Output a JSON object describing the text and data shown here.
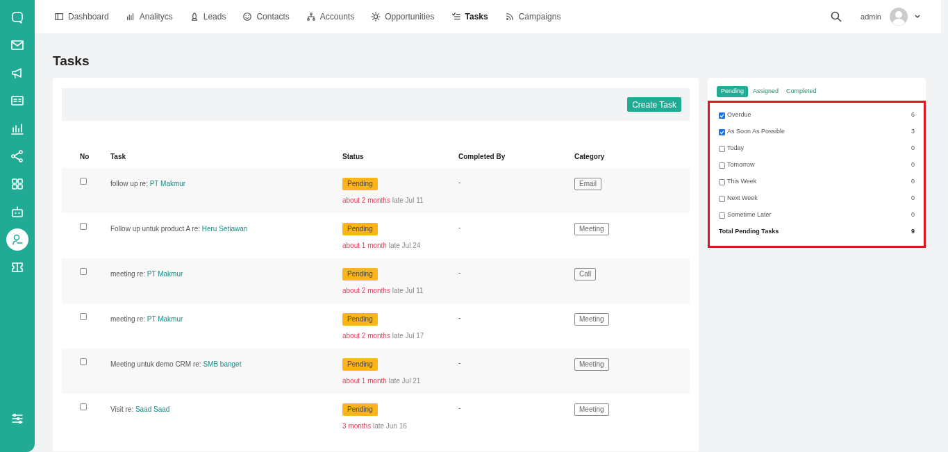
{
  "sidebar": {
    "items": [
      {
        "kind": "chat",
        "selected": false
      },
      {
        "kind": "mail",
        "selected": false
      },
      {
        "kind": "megaphone",
        "selected": false
      },
      {
        "kind": "card",
        "selected": false
      },
      {
        "kind": "chart",
        "selected": false
      },
      {
        "kind": "share",
        "selected": false
      },
      {
        "kind": "grid",
        "selected": false
      },
      {
        "kind": "robot",
        "selected": false
      },
      {
        "kind": "user",
        "selected": true
      },
      {
        "kind": "ticket",
        "selected": false
      }
    ],
    "bottom": {
      "kind": "sliders"
    }
  },
  "nav": {
    "items": [
      {
        "label": "Dashboard",
        "kind": "layout",
        "selected": false
      },
      {
        "label": "Analitycs",
        "kind": "bars",
        "selected": false
      },
      {
        "label": "Leads",
        "kind": "rocket",
        "selected": false
      },
      {
        "label": "Contacts",
        "kind": "smile",
        "selected": false
      },
      {
        "label": "Accounts",
        "kind": "tree",
        "selected": false
      },
      {
        "label": "Opportunities",
        "kind": "sun",
        "selected": false
      },
      {
        "label": "Tasks",
        "kind": "list",
        "selected": true
      },
      {
        "label": "Campaigns",
        "kind": "rss",
        "selected": false
      }
    ],
    "user": "admin"
  },
  "page_title": "Tasks",
  "create_button": "Create Task",
  "table": {
    "columns": [
      "No",
      "Task",
      "Status",
      "Completed By",
      "Category"
    ],
    "rows": [
      {
        "checked": false,
        "task": "follow up re: ",
        "link": "PT Makmur",
        "status": "Pending",
        "due": "about 2 months",
        "due_suffix": " late Jul 11",
        "completed_by": "-",
        "category": "Email"
      },
      {
        "checked": false,
        "task": "Follow up untuk product A re: ",
        "link": "Heru Setiawan",
        "status": "Pending",
        "due": "about 1 month",
        "due_suffix": " late Jul 24",
        "completed_by": "-",
        "category": "Meeting"
      },
      {
        "checked": false,
        "task": "meeting re: ",
        "link": "PT Makmur",
        "status": "Pending",
        "due": "about 2 months",
        "due_suffix": " late Jul 11",
        "completed_by": "-",
        "category": "Call"
      },
      {
        "checked": false,
        "task": "meeting re: ",
        "link": "PT Makmur",
        "status": "Pending",
        "due": "about 2 months",
        "due_suffix": " late Jul 17",
        "completed_by": "-",
        "category": "Meeting"
      },
      {
        "checked": false,
        "task": "Meeting untuk demo CRM re: ",
        "link": "SMB banget",
        "status": "Pending",
        "due": "about 1 month",
        "due_suffix": " late Jul 21",
        "completed_by": "-",
        "category": "Meeting"
      },
      {
        "checked": false,
        "task": "Visit re: ",
        "link": "Saad Saad",
        "status": "Pending",
        "due": "3 months",
        "due_suffix": " late Jun 16",
        "completed_by": "-",
        "category": "Meeting"
      }
    ]
  },
  "side_panel": {
    "tabs": [
      {
        "label": "Pending",
        "selected": true
      },
      {
        "label": "Assigned",
        "selected": false
      },
      {
        "label": "Completed",
        "selected": false
      }
    ],
    "highlighted": true,
    "filters": [
      {
        "label": "Overdue",
        "checked": true,
        "count": "6"
      },
      {
        "label": "As Soon As Possible",
        "checked": true,
        "count": "3"
      },
      {
        "label": "Today",
        "checked": false,
        "count": "0"
      },
      {
        "label": "Tomorrow",
        "checked": false,
        "count": "0"
      },
      {
        "label": "This Week",
        "checked": false,
        "count": "0"
      },
      {
        "label": "Next Week",
        "checked": false,
        "count": "0"
      },
      {
        "label": "Sometime Later",
        "checked": false,
        "count": "0"
      }
    ],
    "total": {
      "label": "Total Pending Tasks",
      "count": "9"
    }
  }
}
